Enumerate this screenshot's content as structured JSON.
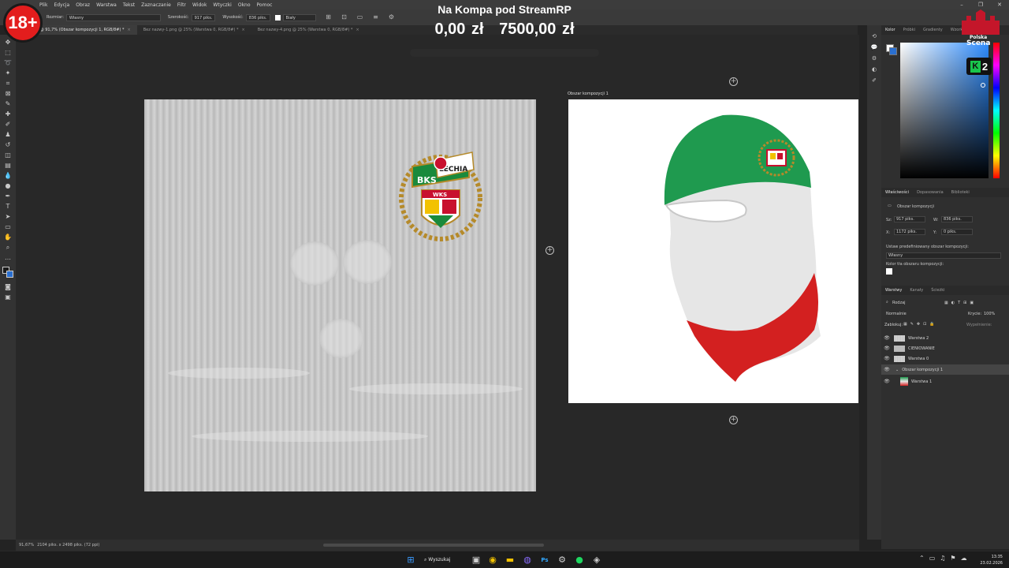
{
  "menu": [
    "Plik",
    "Edycja",
    "Obraz",
    "Warstwa",
    "Tekst",
    "Zaznaczanie",
    "Filtr",
    "Widok",
    "Wtyczki",
    "Okno",
    "Pomoc"
  ],
  "options": {
    "size_label": "Rozmiar:",
    "size_value": "Własny",
    "width_label": "Szerokość:",
    "width_value": "917 piks.",
    "height_label": "Wysokość:",
    "height_value": "836 piks.",
    "fill_value": "Biały"
  },
  "tabs": [
    {
      "label": "...1.png @ 91,7% (Obszar kompozycji 1, RGB/8#) *",
      "active": true
    },
    {
      "label": "Bez nazwy-1.png @ 25% (Warstwa 0, RGB/8#) *",
      "active": false
    },
    {
      "label": "Bez nazwy-4.png @ 25% (Warstwa 0, RGB/8#) *",
      "active": false
    }
  ],
  "artboard_label": "Obszar kompozycji 1",
  "crest": {
    "left_text": "BKS",
    "right_text": "LECHIA",
    "band_text": "WKS"
  },
  "status": {
    "zoom": "91,67%",
    "doc": "2104 piks. x 2498 piks. (72 ppi)"
  },
  "overlay": {
    "title": "Na Kompa pod StreamRP",
    "current": "0,00 zł",
    "goal": "7500,00 zł",
    "progress": 0,
    "age_badge": "18+",
    "logo_line1": "Polska",
    "logo_line2": "Scena",
    "k2_letter": "K",
    "k2_number": "2"
  },
  "panels": {
    "color_tabs": [
      "Kolor",
      "Próbki",
      "Gradienty",
      "Wzorki"
    ],
    "props_tabs": [
      "Właściwości",
      "Dopasowania",
      "Biblioteki"
    ],
    "props_title": "Obszar kompozycji",
    "w_label": "Sz:",
    "w_value": "917 piks.",
    "h_label": "W:",
    "h_value": "836 piks.",
    "x_label": "X:",
    "x_value": "1172 piks.",
    "y_label": "Y:",
    "y_value": "0 piks.",
    "preset_label": "Ustaw predefiniowany obszar kompozycji:",
    "preset_value": "Własny",
    "bg_label": "Kolor tła obszaru kompozycji:",
    "layer_tabs": [
      "Warstwy",
      "Kanały",
      "Ścieżki"
    ],
    "kind_label": "Rodzaj",
    "blend_mode": "Normalnie",
    "opacity_label": "Krycie:",
    "opacity_value": "100%",
    "lock_label": "Zablokuj:",
    "fill_label": "Wypełnienie:",
    "layers": [
      {
        "name": "Warstwa 2",
        "thumb": "stripes"
      },
      {
        "name": "CIENIOWANIE",
        "thumb": "mask"
      },
      {
        "name": "Warstwa 0",
        "thumb": "stripes"
      },
      {
        "name": "Obszar kompozycji 1",
        "thumb": "none"
      },
      {
        "name": "Warstwa 1",
        "thumb": "fig"
      }
    ]
  },
  "taskbar": {
    "search": "Wyszukaj",
    "time": "13:35",
    "date": "23.02.2026"
  },
  "colors": {
    "mask_green": "#1f9a4f",
    "mask_white": "#e6e6e6",
    "mask_red": "#d32020",
    "badge_red": "#e31d1d",
    "accent_blue": "#2d8cff"
  }
}
